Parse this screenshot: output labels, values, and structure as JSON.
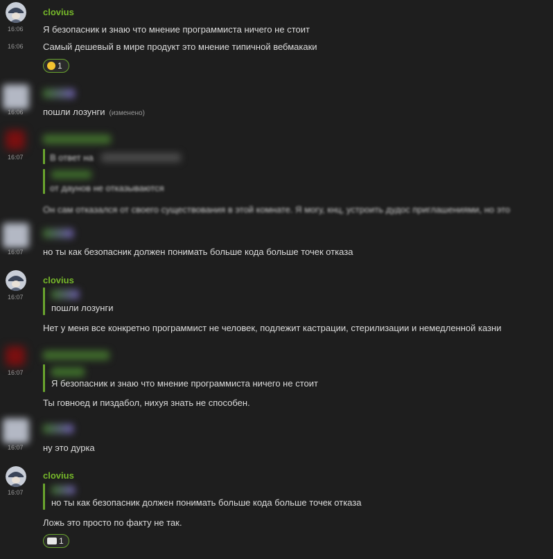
{
  "messages": {
    "m1": {
      "sender": "clovius",
      "time1": "16:06",
      "text1": "Я безопасник и знаю что мнение программиста ничего не стоит",
      "time2": "16:06",
      "text2": "Самый дешевый в мире продукт это мнение типичной вебмакаки",
      "reaction_count": "1",
      "reaction_icon": "grinning-face-icon"
    },
    "m2": {
      "time": "16:06",
      "text": "пошли лозунги",
      "edited": "(изменено)"
    },
    "m3": {
      "time": "16:07",
      "reply_label": "В ответ на",
      "quote_text": "от даунов не отказываются",
      "text": "Он сам отказался от своего существования в этой комнате. Я могу, кнц, устроить дудос приглашениями, но это"
    },
    "m4": {
      "time": "16:07",
      "text": "но ты как безопасник должен понимать больше кода больше точек отказа"
    },
    "m5": {
      "sender": "clovius",
      "time": "16:07",
      "quote_text": "пошли лозунги",
      "text": "Нет у меня все конкретно программист не человек, подлежит кастрации, стерилизации и немедленной казни"
    },
    "m6": {
      "time": "16:07",
      "quote_text": "Я безопасник и знаю что мнение программиста ничего не стоит",
      "text": "Ты говноед и пиздабол, нихуя знать не способен."
    },
    "m7": {
      "time": "16:07",
      "text": "ну это дурка"
    },
    "m8": {
      "sender": "clovius",
      "time": "16:07",
      "quote_text": "но ты как безопасник должен понимать больше кода больше точек отказа",
      "text": "Ложь это просто по факту не так.",
      "reaction_count": "1",
      "reaction_icon": "ambulance-icon"
    }
  },
  "colors": {
    "background": "#1e1e1e",
    "sender_name": "#76b82a",
    "quote_bar": "#6aa52e",
    "timestamp": "#9a9a9a",
    "text": "#dcdcdc"
  }
}
